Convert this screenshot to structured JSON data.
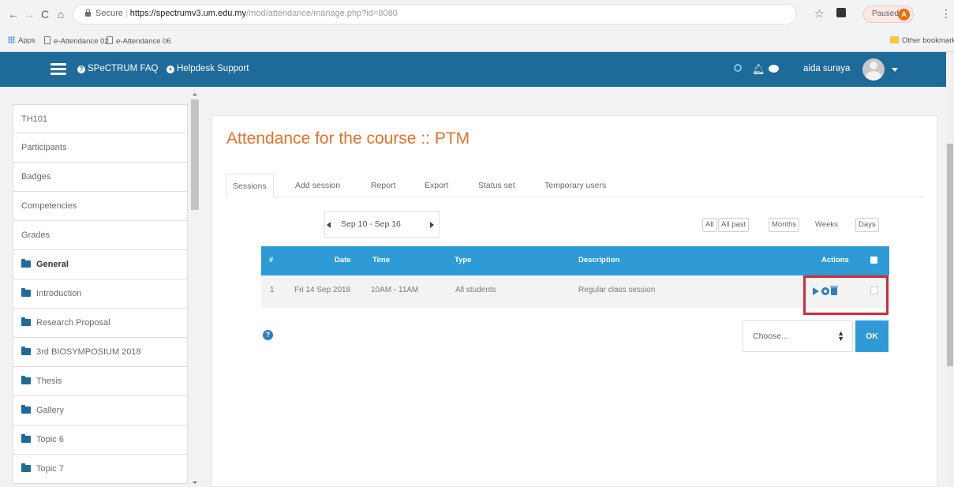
{
  "browser": {
    "omnibox": {
      "secure_label": "Secure",
      "host": "https://spectrumv3.um.edu.my",
      "path": "/mod/attendance/manage.php?id=8080"
    },
    "paused_label": "Paused",
    "profile_initial": "A",
    "bookmarks": {
      "apps": "Apps",
      "items": [
        "e-Attendance 02",
        "e-Attendance 06"
      ],
      "other": "Other bookmarks"
    }
  },
  "navbar": {
    "faq_label": "SPeCTRUM FAQ",
    "helpdesk_label": "Helpdesk Support",
    "user_name": "aida suraya"
  },
  "sidebar": {
    "items": [
      {
        "label": "TH101",
        "folder": false,
        "bold": false
      },
      {
        "label": "Participants",
        "folder": false,
        "bold": false
      },
      {
        "label": "Badges",
        "folder": false,
        "bold": false
      },
      {
        "label": "Competencies",
        "folder": false,
        "bold": false
      },
      {
        "label": "Grades",
        "folder": false,
        "bold": false
      },
      {
        "label": "General",
        "folder": true,
        "bold": true
      },
      {
        "label": "Introduction",
        "folder": true,
        "bold": false
      },
      {
        "label": "Research Proposal",
        "folder": true,
        "bold": false
      },
      {
        "label": "3rd BIOSYMPOSIUM 2018",
        "folder": true,
        "bold": false
      },
      {
        "label": "Thesis",
        "folder": true,
        "bold": false
      },
      {
        "label": "Gallery",
        "folder": true,
        "bold": false
      },
      {
        "label": "Topic 6",
        "folder": true,
        "bold": false
      },
      {
        "label": "Topic 7",
        "folder": true,
        "bold": false
      }
    ]
  },
  "main": {
    "title": "Attendance for the course :: PTM",
    "tabs": [
      "Sessions",
      "Add session",
      "Report",
      "Export",
      "Status set",
      "Temporary users"
    ],
    "active_tab": "Sessions",
    "week_range": "Sep 10 - Sep 16",
    "views": [
      "All",
      "All past",
      "Months",
      "Weeks",
      "Days"
    ],
    "table": {
      "headers": {
        "index": "#",
        "date": "Date",
        "time": "Time",
        "type": "Type",
        "description": "Description",
        "actions": "Actions"
      },
      "rows": [
        {
          "index": "1",
          "date": "Fri 14 Sep 2018",
          "time": "10AM - 11AM",
          "type": "All students",
          "description": "Regular class session"
        }
      ]
    },
    "bulk_select_placeholder": "Choose...",
    "ok_label": "OK",
    "help_glyph": "?"
  }
}
